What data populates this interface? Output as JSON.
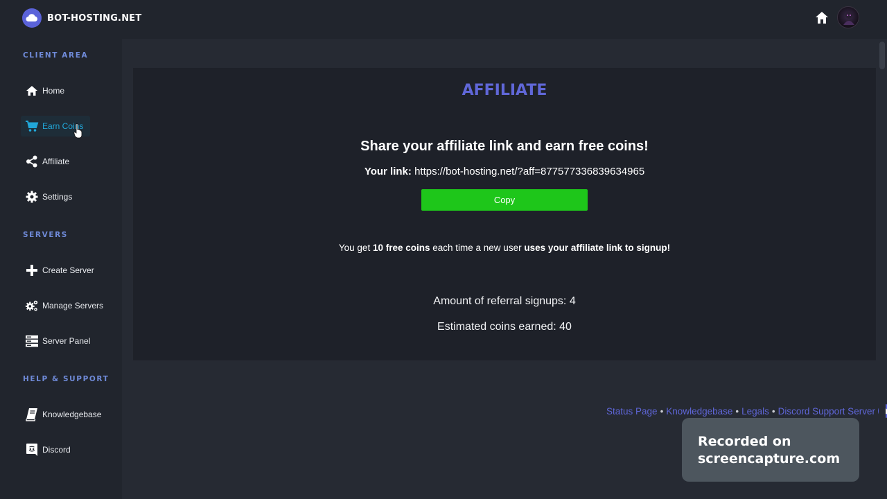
{
  "brand": {
    "name": "BOT-HOSTING.NET",
    "logo_icon": "cloud-icon",
    "accent": "#5b63d9"
  },
  "topbar": {
    "home_icon": "home-icon",
    "avatar_icon": "avatar"
  },
  "sidebar": {
    "sections": [
      {
        "title": "CLIENT AREA"
      },
      {
        "title": "SERVERS"
      },
      {
        "title": "HELP & SUPPORT"
      }
    ],
    "items": [
      {
        "label": "Home",
        "icon": "home-icon"
      },
      {
        "label": "Earn Coins",
        "icon": "cart-icon",
        "active": true
      },
      {
        "label": "Affiliate",
        "icon": "share-icon"
      },
      {
        "label": "Settings",
        "icon": "gear-icon"
      },
      {
        "label": "Create Server",
        "icon": "plus-icon"
      },
      {
        "label": "Manage Servers",
        "icon": "gears-icon"
      },
      {
        "label": "Server Panel",
        "icon": "server-icon"
      },
      {
        "label": "Knowledgebase",
        "icon": "book-icon"
      },
      {
        "label": "Discord",
        "icon": "discord-icon"
      }
    ]
  },
  "main": {
    "title": "AFFILIATE",
    "headline": "Share your affiliate link and earn free coins!",
    "link_label": "Your link:",
    "link_url": "https://bot-hosting.net/?aff=877577336839634965",
    "copy_label": "Copy",
    "info": {
      "part1": "You get ",
      "bold1": "10 free coins",
      "part2": " each time a new user ",
      "bold2": "uses your affiliate link to signup!"
    },
    "referrals": "Amount of referral signups: 4",
    "coins_earned": "Estimated coins earned: 40"
  },
  "footer": {
    "links": [
      "Status Page",
      "Knowledgebase",
      "Legals",
      "Discord Support Server"
    ],
    "separator": "•"
  },
  "watermark": {
    "line1": "Recorded on",
    "line2": "screencapture.com"
  },
  "colors": {
    "copy_button": "#1ec61a",
    "title": "#6067d8",
    "active_nav": "#21a7d9"
  }
}
